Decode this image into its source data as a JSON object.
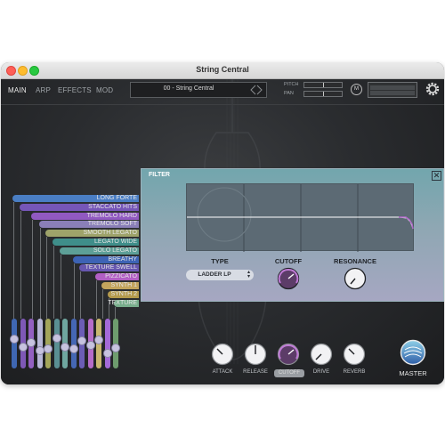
{
  "window": {
    "title": "String Central"
  },
  "nav": {
    "tabs": [
      {
        "label": "MAIN"
      },
      {
        "label": "ARP"
      },
      {
        "label": "EFFECTS"
      },
      {
        "label": "MOD"
      }
    ]
  },
  "preset": {
    "name": "00 - String Central"
  },
  "controls": {
    "pitch_label": "PITCH",
    "pan_label": "PAN",
    "m_button": "M"
  },
  "articulations": [
    {
      "label": "LONG FORTE",
      "color": "#4a7ec4"
    },
    {
      "label": "STACCATO HITS",
      "color": "#7656b8"
    },
    {
      "label": "TREMOLO HARD",
      "color": "#9159c1"
    },
    {
      "label": "TREMOLO SOFT",
      "color": "#8a7fb8"
    },
    {
      "label": "SMOOTH LEGATO",
      "color": "#9ea36a"
    },
    {
      "label": "LEGATO WIDE",
      "color": "#3f8e8a"
    },
    {
      "label": "SOLO LEGATO",
      "color": "#5d9f97"
    },
    {
      "label": "BREATHY",
      "color": "#3d63b5"
    },
    {
      "label": "TEXTURE SWELL",
      "color": "#6757b0"
    },
    {
      "label": "PIZZICATO",
      "color": "#b25fc4"
    },
    {
      "label": "SYNTH 1",
      "color": "#c3a45d"
    },
    {
      "label": "SYNTH 2",
      "color": "#b49a4d"
    },
    {
      "label": "TEXTURE",
      "color": "#78ad8c"
    }
  ],
  "faders": [
    {
      "color": "#3f67b2",
      "level": 0.6
    },
    {
      "color": "#7e58b6",
      "level": 0.42
    },
    {
      "color": "#9360c0",
      "level": 0.52
    },
    {
      "color": "#b8b8d8",
      "level": 0.33
    },
    {
      "color": "#a3a55a",
      "level": 0.38
    },
    {
      "color": "#5a8f93",
      "level": 0.64
    },
    {
      "color": "#6fa69f",
      "level": 0.42
    },
    {
      "color": "#4567b4",
      "level": 0.38
    },
    {
      "color": "#6c5db6",
      "level": 0.57
    },
    {
      "color": "#b56cc9",
      "level": 0.46
    },
    {
      "color": "#c9b870",
      "level": 0.58
    },
    {
      "color": "#a46ad8",
      "level": 0.27
    },
    {
      "color": "#6e9c6e",
      "level": 0.4
    }
  ],
  "filter": {
    "title": "FILTER",
    "close_icon": "close-icon",
    "type_label": "TYPE",
    "type_value": "LADDER LP",
    "cutoff_label": "CUTOFF",
    "resonance_label": "RESONANCE"
  },
  "knobs": [
    {
      "label": "ATTACK"
    },
    {
      "label": "RELEASE"
    },
    {
      "label": "CUTOFF"
    },
    {
      "label": "DRIVE"
    },
    {
      "label": "REVERB"
    }
  ],
  "master": {
    "label": "MASTER"
  },
  "colors": {
    "accent_purple": "#b06ac8",
    "filter_panel": "#8fa7b3",
    "background": "#2a2c2f"
  }
}
